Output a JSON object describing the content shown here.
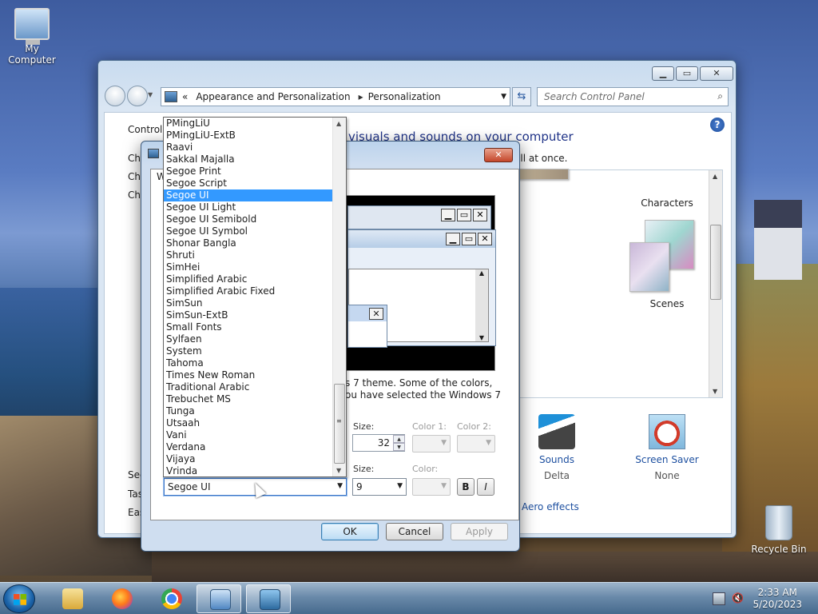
{
  "desktop": {
    "icons": [
      {
        "label": "My Computer"
      },
      {
        "label": "Recycle Bin"
      }
    ]
  },
  "control_panel": {
    "breadcrumb": {
      "prefix": "«",
      "items": [
        "Appearance and Personalization",
        "Personalization"
      ]
    },
    "search_placeholder": "Search Control Panel",
    "side_links": [
      "Control P",
      "Ch",
      "Ch",
      "Ch",
      "See",
      "Tas",
      "Eas"
    ],
    "heading": "visuals and sounds on your computer",
    "subheading": "w color, sounds, and screen saver all at once.",
    "themes": [
      "Characters",
      "Scenes"
    ],
    "bottom_items": [
      {
        "label": "Sounds",
        "value": "Delta"
      },
      {
        "label": "Screen Saver",
        "value": "None"
      }
    ],
    "aero_link": "Aero effects"
  },
  "dialog": {
    "tab_label": "W",
    "explanation_line1": "s 7 theme.  Some of the colors,",
    "explanation_line2": "ou have selected the Windows 7",
    "item_size_label": "Size:",
    "item_size_value": "32",
    "color1_label": "Color 1:",
    "color2_label": "Color 2:",
    "font_size_label": "Size:",
    "font_size_value": "9",
    "font_color_label": "Color:",
    "bold_label": "B",
    "italic_label": "I",
    "font_value": "Segoe UI",
    "ok_label": "OK",
    "cancel_label": "Cancel",
    "apply_label": "Apply"
  },
  "font_list": {
    "items": [
      "PMingLiU",
      "PMingLiU-ExtB",
      "Raavi",
      "Sakkal Majalla",
      "Segoe Print",
      "Segoe Script",
      "Segoe UI",
      "Segoe UI Light",
      "Segoe UI Semibold",
      "Segoe UI Symbol",
      "Shonar Bangla",
      "Shruti",
      "SimHei",
      "Simplified Arabic",
      "Simplified Arabic Fixed",
      "SimSun",
      "SimSun-ExtB",
      "Small Fonts",
      "Sylfaen",
      "System",
      "Tahoma",
      "Times New Roman",
      "Traditional Arabic",
      "Trebuchet MS",
      "Tunga",
      "Utsaah",
      "Vani",
      "Verdana",
      "Vijaya",
      "Vrinda"
    ],
    "selected": "Segoe UI"
  },
  "taskbar": {
    "time": "2:33 AM",
    "date": "5/20/2023",
    "apps": [
      "start-button",
      "file-explorer-icon",
      "firefox-icon",
      "chrome-icon",
      "control-panel-icon",
      "window-color-icon"
    ]
  },
  "colors": {
    "selection": "#3399ff",
    "link": "#1e50a0",
    "heading": "#1e3287"
  }
}
